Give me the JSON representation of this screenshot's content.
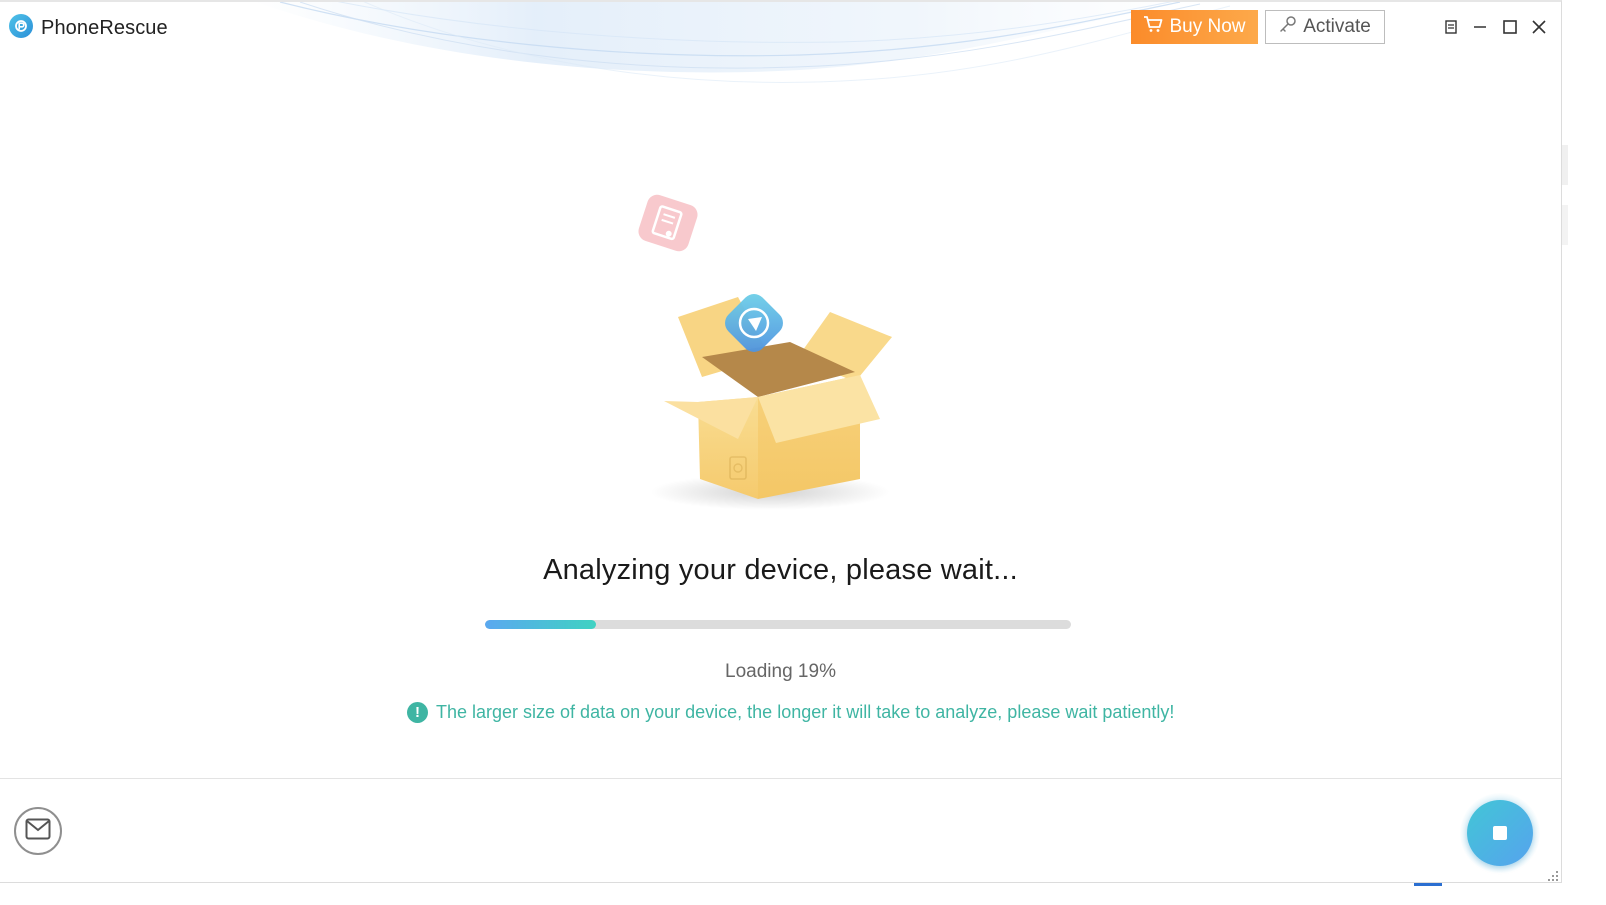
{
  "app": {
    "title": "PhoneRescue",
    "logo_icon": "phonerescue-logo-icon"
  },
  "header": {
    "buy_label": "Buy Now",
    "buy_icon": "cart-icon",
    "activate_label": "Activate",
    "activate_icon": "key-icon",
    "window_controls": [
      "menu-icon",
      "minimize-icon",
      "maximize-icon",
      "close-icon"
    ]
  },
  "main": {
    "headline": "Analyzing your device, please wait...",
    "progress_percent": 19,
    "loading_text": "Loading 19%",
    "hint_text": "The larger size of data on your device, the longer it will take to analyze, please wait patiently!",
    "hint_icon_glyph": "!"
  },
  "footer": {
    "feedback_icon": "mail-icon",
    "stop_icon": "stop-icon"
  },
  "colors": {
    "accent_orange": "#fb8b2a",
    "accent_teal": "#3fb5a3",
    "progress_start": "#5aa8f0",
    "progress_end": "#3fd2c2",
    "stop_button": "#42c6d6"
  }
}
